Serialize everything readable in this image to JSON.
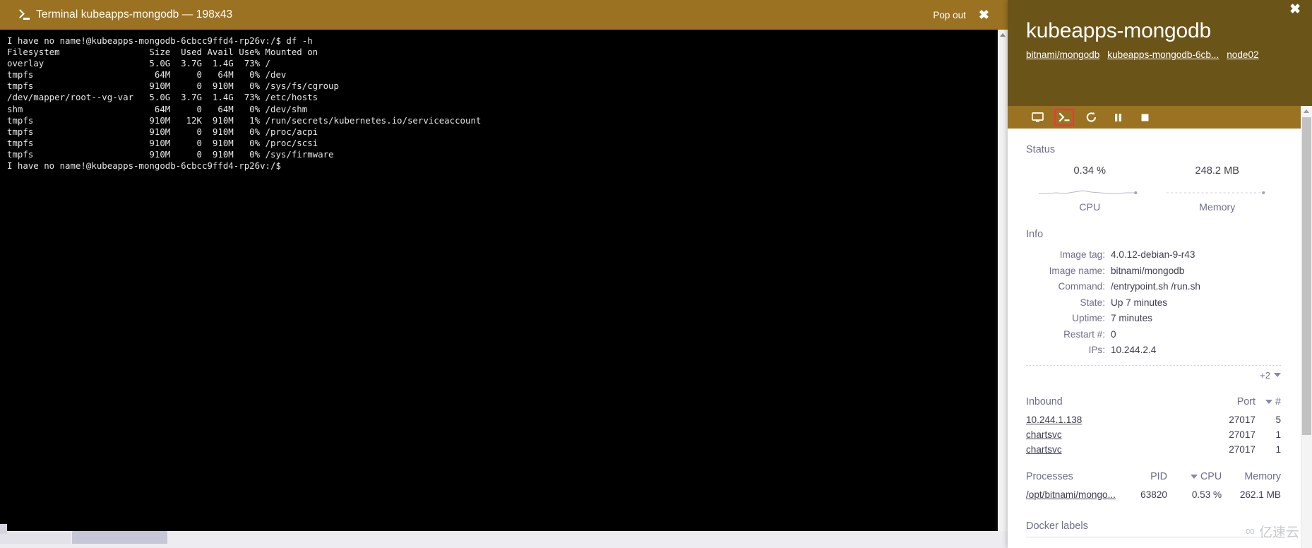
{
  "terminal": {
    "title": "Terminal kubeapps-mongodb — 198x43",
    "prompt_icon": "terminal-prompt-icon",
    "popout_label": "Pop out",
    "close_icon": "close-icon",
    "content": "I have no name!@kubeapps-mongodb-6cbcc9ffd4-rp26v:/$ df -h\nFilesystem                 Size  Used Avail Use% Mounted on\noverlay                    5.0G  3.7G  1.4G  73% /\ntmpfs                       64M     0   64M   0% /dev\ntmpfs                      910M     0  910M   0% /sys/fs/cgroup\n/dev/mapper/root--vg-var   5.0G  3.7G  1.4G  73% /etc/hosts\nshm                         64M     0   64M   0% /dev/shm\ntmpfs                      910M   12K  910M   1% /run/secrets/kubernetes.io/serviceaccount\ntmpfs                      910M     0  910M   0% /proc/acpi\ntmpfs                      910M     0  910M   0% /proc/scsi\ntmpfs                      910M     0  910M   0% /sys/firmware\nI have no name!@kubeapps-mongodb-6cbcc9ffd4-rp26v:/$ "
  },
  "panel": {
    "close_icon": "close-icon",
    "title": "kubeapps-mongodb",
    "links": [
      {
        "label": "bitnami/mongodb",
        "name": "panel-link-image"
      },
      {
        "label": "kubeapps-mongodb-6cb...",
        "name": "panel-link-pod"
      },
      {
        "label": "node02",
        "name": "panel-link-node"
      }
    ],
    "toolbar": [
      {
        "icon": "monitor-icon",
        "name": "toolbar-attach-button",
        "selected": false
      },
      {
        "icon": "terminal-icon",
        "name": "toolbar-terminal-button",
        "selected": true
      },
      {
        "icon": "restart-icon",
        "name": "toolbar-restart-button",
        "selected": false
      },
      {
        "icon": "pause-icon",
        "name": "toolbar-pause-button",
        "selected": false
      },
      {
        "icon": "stop-icon",
        "name": "toolbar-stop-button",
        "selected": false
      }
    ],
    "status": {
      "label": "Status",
      "metrics": [
        {
          "value": "0.34 %",
          "name": "CPU"
        },
        {
          "value": "248.2 MB",
          "name": "Memory"
        }
      ]
    },
    "info": {
      "label": "Info",
      "rows": [
        {
          "key": "Image tag:",
          "value": "4.0.12-debian-9-r43"
        },
        {
          "key": "Image name:",
          "value": "bitnami/mongodb"
        },
        {
          "key": "Command:",
          "value": "/entrypoint.sh /run.sh"
        },
        {
          "key": "State:",
          "value": "Up 7 minutes"
        },
        {
          "key": "Uptime:",
          "value": "7 minutes"
        },
        {
          "key": "Restart #:",
          "value": "0"
        },
        {
          "key": "IPs:",
          "value": "10.244.2.4"
        }
      ],
      "more_label": "+2"
    },
    "inbound": {
      "headers": [
        "Inbound",
        "Port",
        "#"
      ],
      "sorted_column": "Port",
      "rows": [
        {
          "source": "10.244.1.138",
          "port": "27017",
          "count": "5"
        },
        {
          "source": "chartsvc",
          "port": "27017",
          "count": "1"
        },
        {
          "source": "chartsvc",
          "port": "27017",
          "count": "1"
        }
      ]
    },
    "processes": {
      "headers": [
        "Processes",
        "PID",
        "CPU",
        "Memory"
      ],
      "sorted_column": "CPU",
      "rows": [
        {
          "command": "/opt/bitnami/mongo...",
          "pid": "63820",
          "cpu": "0.53 %",
          "memory": "262.1 MB"
        }
      ]
    },
    "docker_labels": {
      "label": "Docker labels"
    }
  },
  "watermark": {
    "text": "亿速云",
    "mark": "∞"
  },
  "colors": {
    "title_bar": "#9a7222",
    "panel_header": "#6b5418",
    "panel_toolbar": "#9a7222",
    "selected_outline": "#e8393a",
    "terminal_bg": "#000000",
    "terminal_fg": "#e6e6e6",
    "muted_text": "#6e6e8a",
    "value_text": "#3e3e50"
  }
}
